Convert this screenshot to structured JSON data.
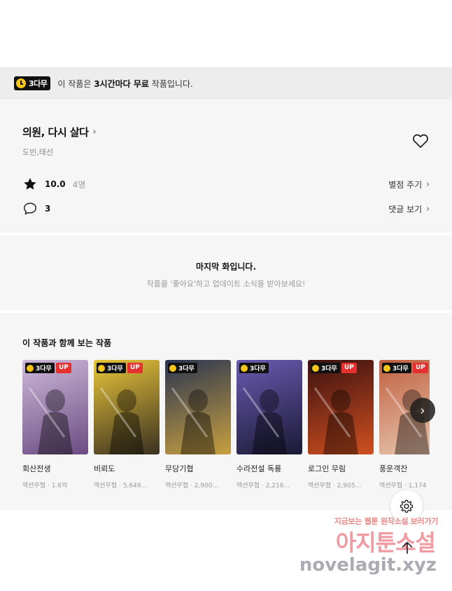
{
  "banner": {
    "badge": "3다무",
    "text_pre": "이 작품은 ",
    "text_bold": "3시간마다 무료",
    "text_post": " 작품입니다."
  },
  "work": {
    "title": "의원, 다시 살다",
    "authors": "도빈,태선",
    "rating": "10.0",
    "rating_count": "4명",
    "rate_link": "별점 주기",
    "comments": "3",
    "comments_link": "댓글 보기"
  },
  "last_episode": {
    "heading": "마지막 화입니다.",
    "sub": "작품을 '좋아요'하고 업데이트 소식을 받아보세요!"
  },
  "recommendations": {
    "title": "이 작품과 함께 보는 작품",
    "badge": "3다무",
    "up": "UP",
    "items": [
      {
        "name": "회산전생",
        "meta": "액션무협 · 1.6억",
        "up": true,
        "colors": [
          "#cdb8d8",
          "#6b4c82"
        ]
      },
      {
        "name": "비뢰도",
        "meta": "액션무협 · 5,649...",
        "up": true,
        "colors": [
          "#e8c53a",
          "#3a3020"
        ]
      },
      {
        "name": "무당기협",
        "meta": "액션무협 · 2,900...",
        "up": false,
        "colors": [
          "#2a3550",
          "#c8a040"
        ]
      },
      {
        "name": "수라전설 독룡",
        "meta": "액션무협 · 2,216...",
        "up": false,
        "colors": [
          "#6a5ab0",
          "#1a1a35"
        ]
      },
      {
        "name": "로그인 무림",
        "meta": "액션무협 · 2,905...",
        "up": true,
        "colors": [
          "#3a1010",
          "#d05020"
        ]
      },
      {
        "name": "풍운객잔",
        "meta": "액션무협 · 1,174",
        "up": true,
        "colors": [
          "#c06040",
          "#e8c8b0"
        ]
      }
    ]
  },
  "watermark": {
    "line1": "지금보는 웹툰 원작소설 보러가기",
    "line2": "아지툰소설",
    "line3": "novelagit.xyz"
  }
}
